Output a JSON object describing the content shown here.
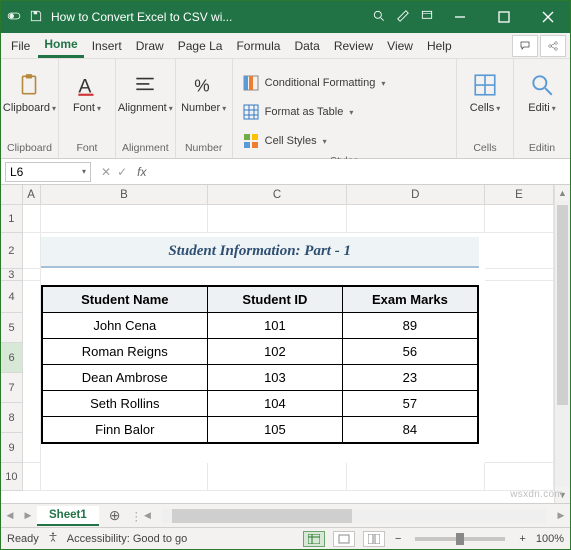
{
  "titlebar": {
    "title": "How to Convert Excel to CSV wi..."
  },
  "menus": {
    "file": "File",
    "home": "Home",
    "insert": "Insert",
    "draw": "Draw",
    "pagelayout": "Page La",
    "formulas": "Formula",
    "data": "Data",
    "review": "Review",
    "view": "View",
    "help": "Help"
  },
  "ribbon": {
    "clipboard": {
      "label": "Clipboard",
      "name": "Clipboard"
    },
    "font": {
      "label": "Font",
      "name": "Font"
    },
    "alignment": {
      "label": "Alignment",
      "name": "Alignment"
    },
    "number": {
      "label": "Number",
      "name": "Number"
    },
    "styles": {
      "name": "Styles",
      "cond": "Conditional Formatting",
      "table": "Format as Table",
      "cell": "Cell Styles"
    },
    "cells": {
      "label": "Cells",
      "name": "Cells"
    },
    "editing": {
      "label": "Editi",
      "name": "Editin"
    }
  },
  "namebox": "L6",
  "fx_value": "",
  "columns": [
    "A",
    "B",
    "C",
    "D",
    "E"
  ],
  "rownums": [
    "1",
    "2",
    "3",
    "4",
    "5",
    "6",
    "7",
    "8",
    "9",
    "10"
  ],
  "sheet": {
    "title": "Student Information: Part - 1",
    "headers": [
      "Student Name",
      "Student ID",
      "Exam Marks"
    ],
    "rows": [
      {
        "name": "John Cena",
        "id": "101",
        "marks": "89"
      },
      {
        "name": "Roman Reigns",
        "id": "102",
        "marks": "56"
      },
      {
        "name": "Dean Ambrose",
        "id": "103",
        "marks": "23"
      },
      {
        "name": "Seth Rollins",
        "id": "104",
        "marks": "57"
      },
      {
        "name": "Finn Balor",
        "id": "105",
        "marks": "84"
      }
    ]
  },
  "tab": "Sheet1",
  "status": {
    "ready": "Ready",
    "access": "Accessibility: Good to go",
    "zoom": "100%"
  },
  "watermark": "wsxdn.com"
}
